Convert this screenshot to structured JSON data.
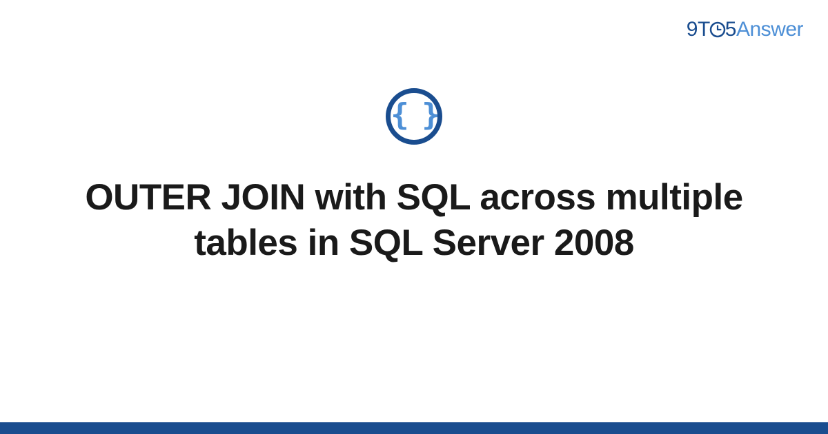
{
  "logo": {
    "part1": "9",
    "part2": "T",
    "part3": "5",
    "part4": "Answer"
  },
  "badge": {
    "icon_name": "code-braces-icon",
    "symbol": "{ }"
  },
  "title": "OUTER JOIN with SQL across multiple tables in SQL Server 2008",
  "colors": {
    "brand_dark": "#1a4d8f",
    "brand_light": "#4d8fd6",
    "text": "#1a1a1a"
  }
}
